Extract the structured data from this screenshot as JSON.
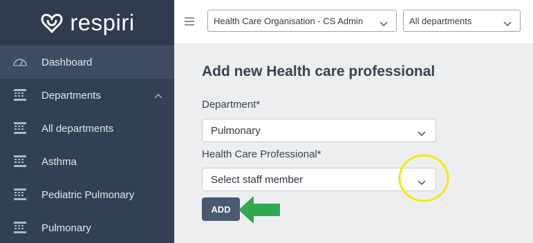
{
  "brand": {
    "name": "respiri"
  },
  "sidebar": {
    "items": [
      {
        "label": "Dashboard",
        "icon": "speedometer-icon",
        "active": true
      },
      {
        "label": "Departments",
        "icon": "building-icon",
        "expanded": true
      },
      {
        "label": "All departments",
        "icon": "building-icon"
      },
      {
        "label": "Asthma",
        "icon": "building-icon"
      },
      {
        "label": "Pediatric Pulmonary",
        "icon": "building-icon"
      },
      {
        "label": "Pulmonary",
        "icon": "building-icon"
      }
    ]
  },
  "topbar": {
    "organisation": "Health Care Organisation - CS Admin",
    "department_filter": "All departments"
  },
  "form": {
    "title": "Add new Health care professional",
    "department_label": "Department*",
    "department_value": "Pulmonary",
    "hcp_label": "Health Care Professional*",
    "hcp_placeholder": "Select staff member",
    "add_label": "ADD"
  },
  "colors": {
    "sidebar_bg": "#324055",
    "sidebar_active": "#3e4c63",
    "button_bg": "#4a5870",
    "highlight_circle": "#f2ea00",
    "arrow_green": "#2fa84f"
  }
}
